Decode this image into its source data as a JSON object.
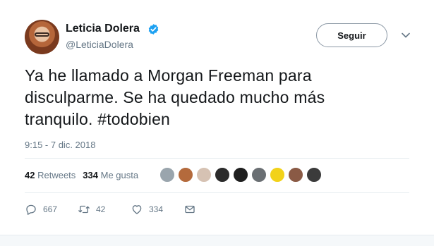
{
  "author": {
    "name": "Leticia Dolera",
    "handle": "@LeticiaDolera",
    "verified_icon": "verified-badge-icon"
  },
  "follow_button": {
    "label": "Seguir"
  },
  "tweet": {
    "lines": [
      "Ya he llamado a Morgan Freeman para",
      "disculparme. Se ha quedado mucho más",
      "tranquilo. #todobien"
    ],
    "timestamp": "9:15 - 7 dic. 2018"
  },
  "stats": {
    "retweets_count": "42",
    "retweets_label": "Retweets",
    "likes_count": "334",
    "likes_label": "Me gusta"
  },
  "liker_avatars": [
    {
      "color": "#9aa5ad"
    },
    {
      "color": "#b46a3c"
    },
    {
      "color": "#d6c2b3"
    },
    {
      "color": "#2b2b2b"
    },
    {
      "color": "#1f1f1f"
    },
    {
      "color": "#6a6f73"
    },
    {
      "color": "#f2d21a"
    },
    {
      "color": "#8a5a45"
    },
    {
      "color": "#3b3b3b"
    }
  ],
  "actions": {
    "reply_count": "667",
    "retweet_count": "42",
    "like_count": "334"
  },
  "colors": {
    "text": "#14171a",
    "muted": "#657786",
    "verified": "#1da1f2",
    "divider": "#e6ecf0"
  }
}
